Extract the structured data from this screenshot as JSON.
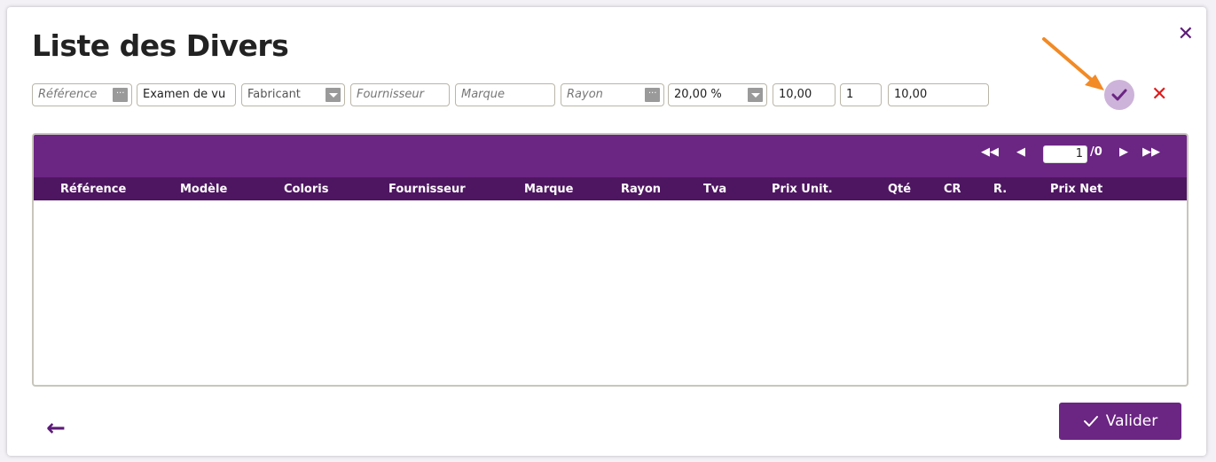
{
  "modal": {
    "title": "Liste des Divers",
    "close_icon": "close-icon"
  },
  "filters": {
    "reference_placeholder": "Référence",
    "modele_value": "Examen de vu",
    "fabricant_placeholder": "Fabricant",
    "fournisseur_placeholder": "Fournisseur",
    "marque_placeholder": "Marque",
    "rayon_placeholder": "Rayon",
    "tva_value": "20,00 %",
    "prix_unit_value": "10,00",
    "qte_value": "1",
    "prix_net_value": "10,00"
  },
  "actions": {
    "confirm_icon": "check-icon",
    "cancel_icon": "close-icon"
  },
  "table": {
    "pager": {
      "current_page": "1",
      "total_pages": "/0"
    },
    "columns": [
      "Référence",
      "Modèle",
      "Coloris",
      "Fournisseur",
      "Marque",
      "Rayon",
      "Tva",
      "Prix Unit.",
      "Qté",
      "CR",
      "R.",
      "Prix Net"
    ],
    "rows": []
  },
  "footer": {
    "back_icon": "arrow-left-icon",
    "validate_label": "Valider"
  },
  "colors": {
    "brand_purple": "#6b2583",
    "header_dark": "#4e1661",
    "cancel_red": "#e01b1b",
    "annotation_orange": "#f28a25"
  }
}
